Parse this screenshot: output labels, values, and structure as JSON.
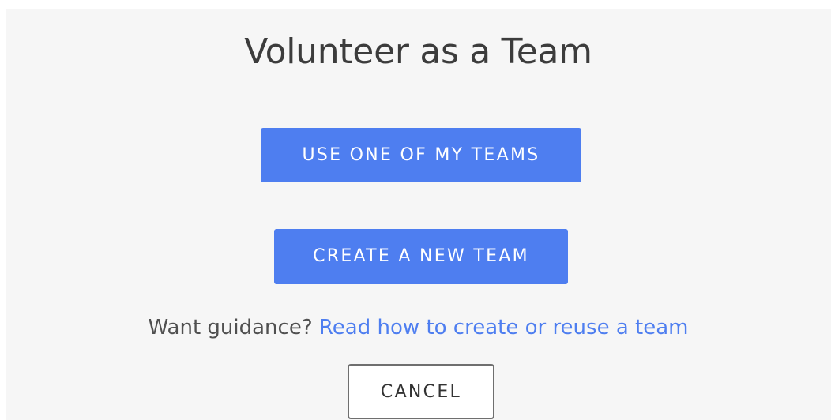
{
  "dialog": {
    "title": "Volunteer as a Team",
    "use_team_label": "USE ONE OF MY TEAMS",
    "create_team_label": "CREATE A NEW TEAM",
    "guidance_prefix": "Want guidance?",
    "guidance_link": "Read how to create or reuse a team",
    "cancel_label": "CANCEL"
  },
  "colors": {
    "primary": "#4e7ef0",
    "panel_background": "#f6f6f6",
    "title_text": "#3c3c3c"
  }
}
